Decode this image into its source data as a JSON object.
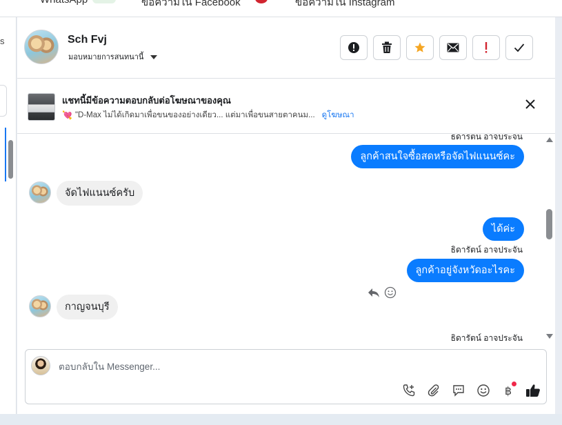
{
  "top_tabs": [
    {
      "label": "WhatsApp"
    },
    {
      "label": "ข้อความใน Facebook"
    },
    {
      "label": "ข้อความใน Instagram"
    }
  ],
  "sidebar": {
    "fragment": "s"
  },
  "header": {
    "contact_name": "Sch Fvj",
    "assign_label": "มอบหมายการสนทนานี้",
    "actions": [
      {
        "icon": "alert-circle-icon",
        "label": "ทำเครื่องหมายว่าเป็นสแปม"
      },
      {
        "icon": "trash-icon",
        "label": "ลบ"
      },
      {
        "icon": "star-icon",
        "label": "ติดดาว"
      },
      {
        "icon": "envelope-icon",
        "label": "ทำเครื่องหมายว่ายังไม่ได้อ่าน"
      },
      {
        "icon": "exclamation-icon",
        "label": "ติดตามผล"
      },
      {
        "icon": "check-icon",
        "label": "เสร็จสิ้น"
      }
    ]
  },
  "ad_banner": {
    "title": "แชทนี้มีข้อความตอบกลับต่อโฆษณาของคุณ",
    "snippet": "\"D-Max ไม่ได้เกิดมาเพื่อขนของอย่างเดียว... แต่มาเพื่อขนสายตาคนม...",
    "link": "ดูโฆษณา"
  },
  "messages": [
    {
      "side": "agent_name",
      "text": "ธิดารัตน์ อาจประจัน"
    },
    {
      "side": "out",
      "text": "ลูกค้าสนใจซื้อสดหรือจัดไฟแนนซ์คะ"
    },
    {
      "side": "in",
      "text": "จัดไฟแนนซ์ครับ"
    },
    {
      "side": "out",
      "text": "ได้ค่ะ"
    },
    {
      "side": "agent_name",
      "text": "ธิดารัตน์ อาจประจัน"
    },
    {
      "side": "out",
      "text": "ลูกค้าอยู่จังหวัดอะไรคะ"
    },
    {
      "side": "in",
      "text": "กาญจนบุรี"
    },
    {
      "side": "agent_name",
      "text": "ธิดารัตน์ อาจประจัน"
    }
  ],
  "composer": {
    "placeholder": "ตอบกลับใน Messenger...",
    "tools": [
      "phone-plus-icon",
      "paperclip-icon",
      "chat-bubble-icon",
      "emoji-icon",
      "baht-icon",
      "thumbs-up-icon"
    ]
  },
  "colors": {
    "accent": "#0a7cff",
    "star": "#f5a623",
    "danger": "#d1242f",
    "notification_dot": "#f02849"
  }
}
